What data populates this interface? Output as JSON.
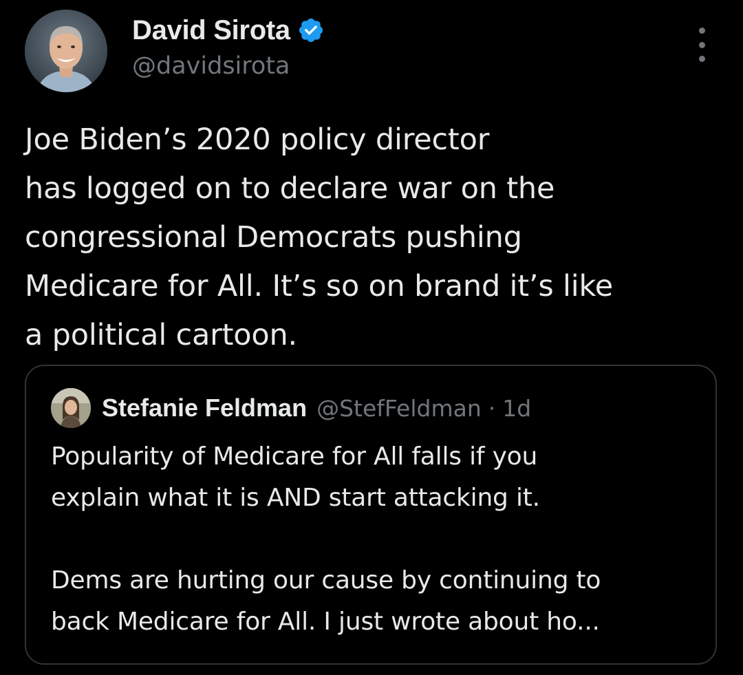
{
  "author": {
    "display_name": "David Sirota",
    "handle": "@davidsirota",
    "verified": true,
    "verified_color": "#1d9bf0",
    "avatar_icon": "avatar-photo"
  },
  "more_menu": {
    "icon": "more-vertical-icon"
  },
  "tweet": {
    "lines": [
      "Joe Biden’s 2020 policy director",
      "has logged on to declare war on the",
      "congressional Democrats pushing",
      "Medicare for All. It’s so on brand it’s like",
      "a political cartoon."
    ]
  },
  "quoted_tweet": {
    "display_name": "Stefanie Feldman",
    "handle": "@StefFeldman",
    "separator": "·",
    "time": "1d",
    "avatar_icon": "avatar-photo",
    "paragraph1": [
      "Popularity of Medicare for All falls if you",
      "explain what it is AND start attacking it."
    ],
    "paragraph2": [
      "Dems are hurting our cause by continuing to",
      "back Medicare for All. I just wrote about ho..."
    ]
  },
  "colors": {
    "background": "#000000",
    "text_primary": "#e7e9ea",
    "text_secondary": "#71767b",
    "border": "#2f3336"
  }
}
